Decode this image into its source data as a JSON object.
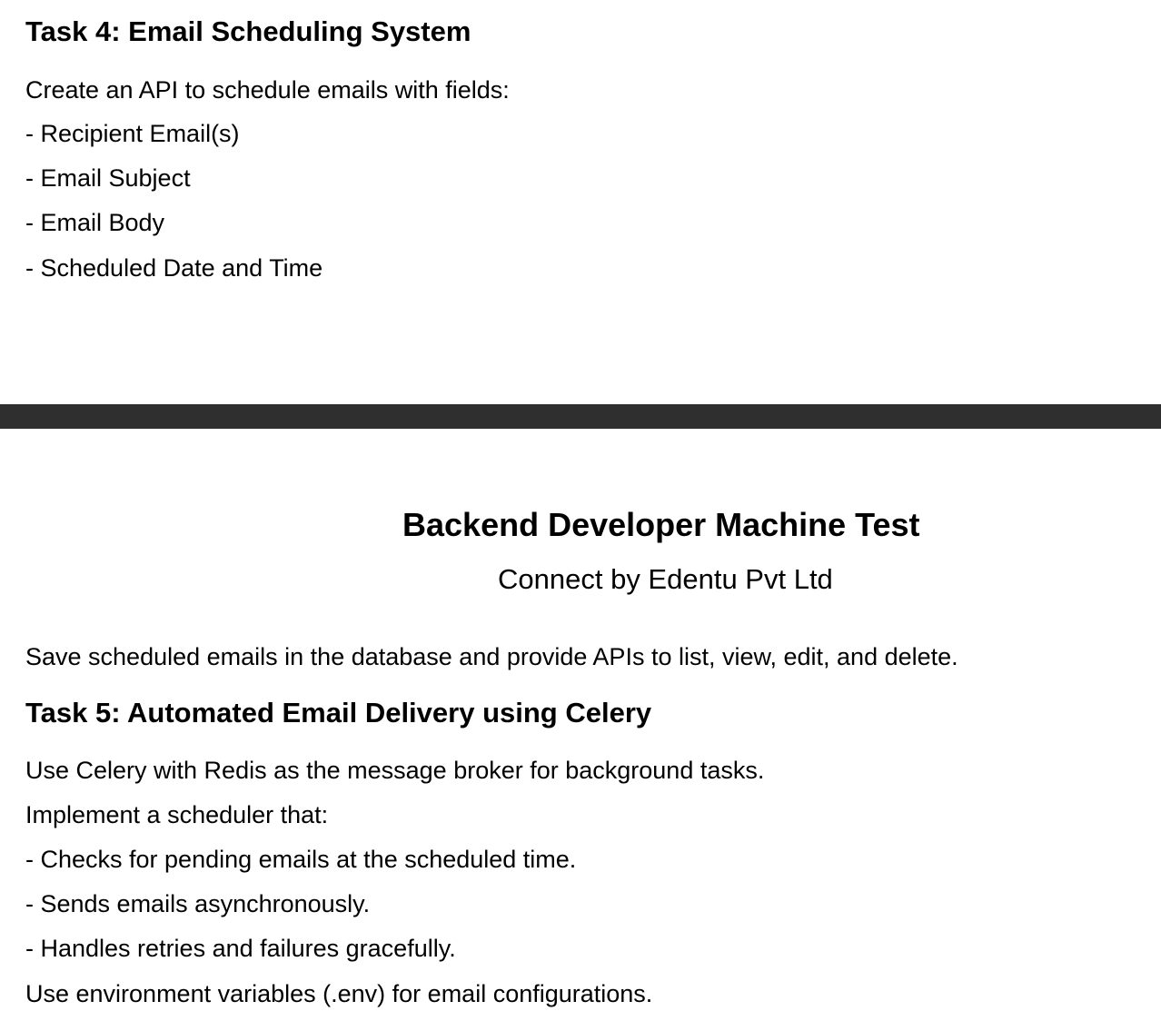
{
  "page1": {
    "task4_heading": "Task 4: Email Scheduling System",
    "task4_intro": "Create an API to schedule emails with fields:",
    "task4_fields": [
      "- Recipient Email(s)",
      "- Email Subject",
      "- Email Body",
      "- Scheduled Date and Time"
    ]
  },
  "page2": {
    "title": "Backend Developer Machine Test",
    "subtitle": "Connect by Edentu Pvt Ltd",
    "task4_continued": "Save scheduled emails in the database and provide APIs to list, view, edit, and delete.",
    "task5_heading": "Task 5: Automated Email Delivery using Celery",
    "task5_lines": [
      "Use Celery with Redis as the message broker for background tasks.",
      "Implement a scheduler that:",
      "- Checks for pending emails at the scheduled time.",
      "- Sends emails asynchronously.",
      "- Handles retries and failures gracefully.",
      "Use environment variables (.env) for email configurations."
    ]
  }
}
